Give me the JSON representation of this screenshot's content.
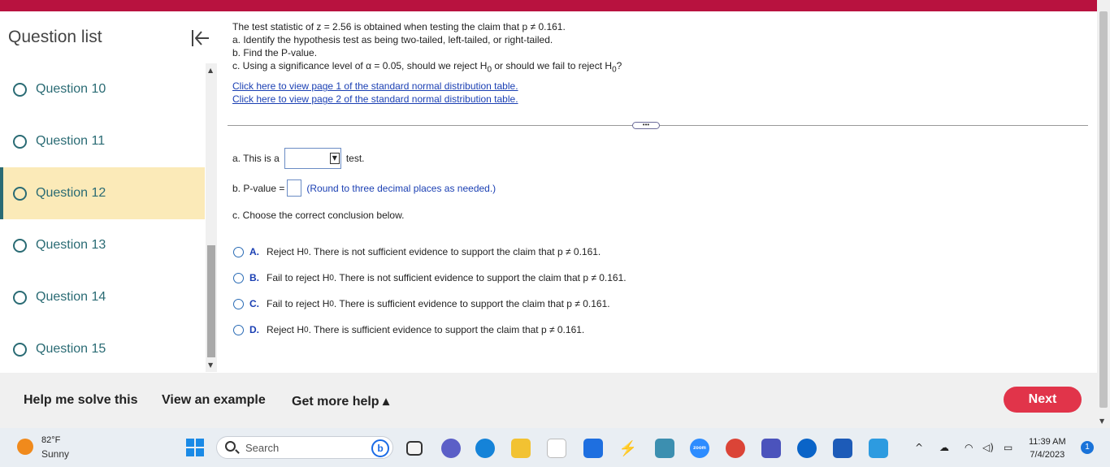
{
  "sidebar": {
    "title": "Question list",
    "items": [
      {
        "label": "Question 10"
      },
      {
        "label": "Question 11"
      },
      {
        "label": "Question 12"
      },
      {
        "label": "Question 13"
      },
      {
        "label": "Question 14"
      },
      {
        "label": "Question 15"
      }
    ],
    "active_index": 2
  },
  "question": {
    "stem": "The test statistic of z = 2.56 is obtained when testing the claim that p ≠ 0.161.",
    "part_a": "a. Identify the hypothesis test as being two-tailed, left-tailed, or right-tailed.",
    "part_b": "b. Find the P-value.",
    "part_c_pre": "c. Using a significance level of α = 0.05, should we reject H",
    "part_c_mid": " or should we fail to reject H",
    "part_c_end": "?",
    "sub0": "0",
    "link1": "Click here to view page 1 of the standard normal distribution table.",
    "link2": "Click here to view page 2 of the standard normal distribution table."
  },
  "answer": {
    "more_label": "•••",
    "a_prefix": "a. This is a",
    "a_suffix": "test.",
    "dropdown_arrow": "▼",
    "b_prefix": "b. P-value =",
    "b_hint": "(Round to three decimal places as needed.)",
    "c_prompt": "c. Choose the correct conclusion below.",
    "options": [
      {
        "letter": "A.",
        "pre": "Reject H",
        "post": ". There is not sufficient evidence to support the claim that p ≠ 0.161."
      },
      {
        "letter": "B.",
        "pre": "Fail to reject H",
        "post": ". There is not sufficient evidence to support the claim that p ≠ 0.161."
      },
      {
        "letter": "C.",
        "pre": "Fail to reject H",
        "post": ". There is sufficient evidence to support the claim that p ≠ 0.161."
      },
      {
        "letter": "D.",
        "pre": "Reject H",
        "post": ". There is sufficient evidence to support the claim that p ≠ 0.161."
      }
    ]
  },
  "footer": {
    "help_solve": "Help me solve this",
    "view_example": "View an example",
    "more_help": "Get more help ▴",
    "next": "Next"
  },
  "taskbar": {
    "temp": "82°F",
    "condition": "Sunny",
    "search_placeholder": "Search",
    "bing_letter": "b",
    "zoom_label": "zoom",
    "time": "11:39 AM",
    "date": "7/4/2023",
    "notifications": "1"
  },
  "colors": {
    "brand_bar": "#b8123f",
    "accent_teal": "#2a6b74",
    "active_bg": "#fbeab8",
    "link_blue": "#1a3fb3",
    "next_red": "#e1344a"
  }
}
